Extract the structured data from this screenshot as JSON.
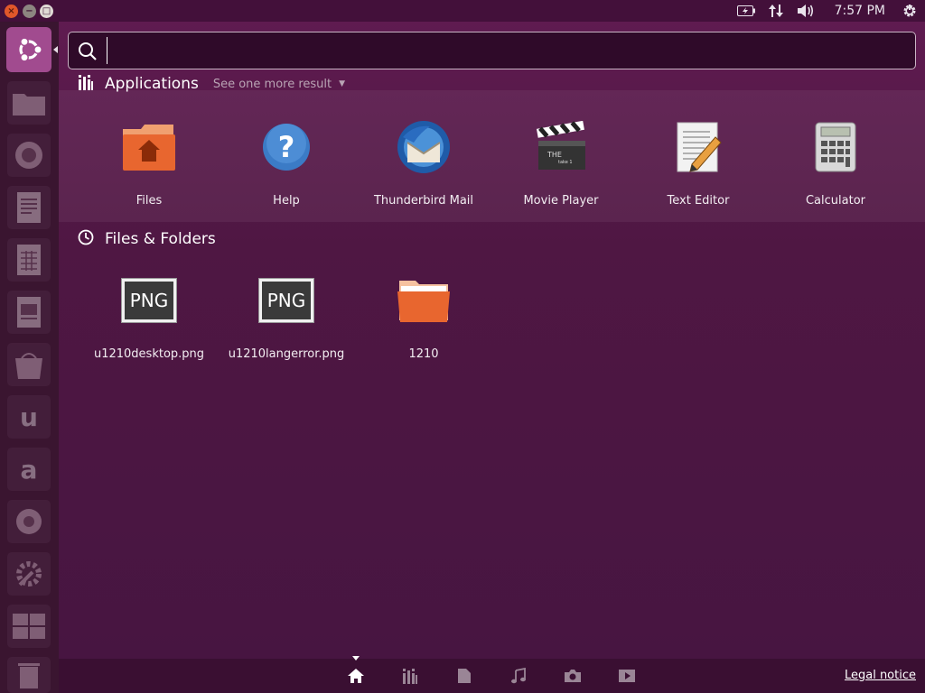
{
  "window_controls": {
    "close": "×",
    "minimize": "−",
    "maximize": "□"
  },
  "panel": {
    "clock": "7:57 PM"
  },
  "search": {
    "value": "",
    "placeholder": ""
  },
  "sections": {
    "applications": {
      "title": "Applications",
      "see_more": "See one more result"
    },
    "files": {
      "title": "Files & Folders"
    }
  },
  "apps": [
    {
      "label": "Files",
      "icon": "files-folder-icon"
    },
    {
      "label": "Help",
      "icon": "help-icon"
    },
    {
      "label": "Thunderbird Mail",
      "icon": "thunderbird-icon"
    },
    {
      "label": "Movie Player",
      "icon": "clapperboard-icon"
    },
    {
      "label": "Text Editor",
      "icon": "text-editor-icon"
    },
    {
      "label": "Calculator",
      "icon": "calculator-icon"
    }
  ],
  "files": [
    {
      "label": "u1210desktop.png",
      "badge": "PNG"
    },
    {
      "label": "u1210langerror.png",
      "badge": "PNG"
    },
    {
      "label": "1210",
      "badge": ""
    }
  ],
  "launcher": {
    "glyphs": {
      "ubuntu_one": "u",
      "amazon": "a"
    }
  },
  "footer": {
    "legal": "Legal notice"
  },
  "colors": {
    "accent": "#a14b8f",
    "folder": "#e8662f",
    "background": "#4f1743"
  }
}
